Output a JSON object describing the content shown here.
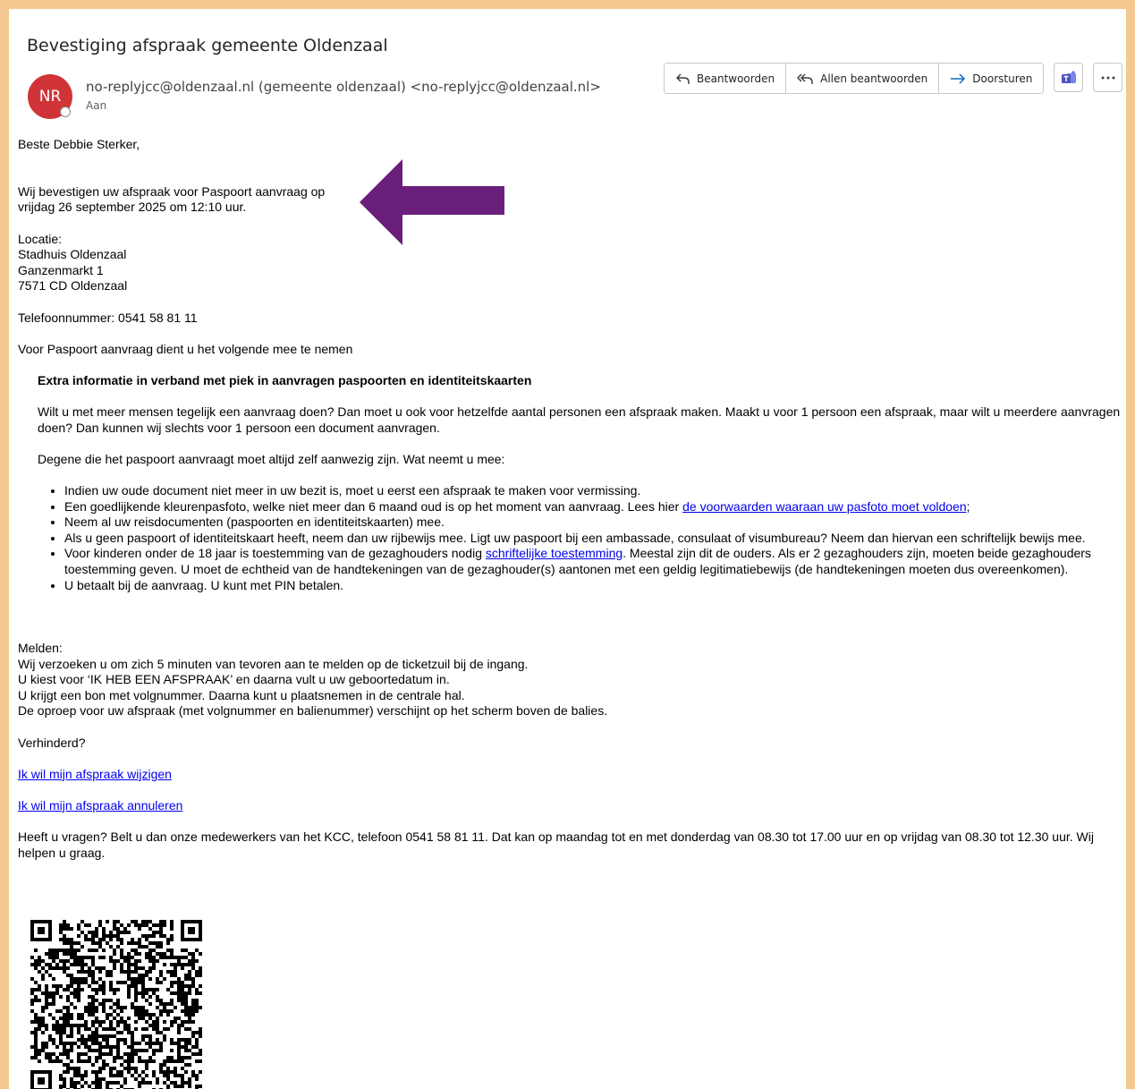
{
  "email": {
    "subject": "Bevestiging afspraak gemeente Oldenzaal",
    "avatar_initials": "NR",
    "avatar_color": "#d13438",
    "sender": "no-replyjcc@oldenzaal.nl (gemeente oldenzaal) <no-replyjcc@oldenzaal.nl>",
    "to_label": "Aan"
  },
  "actions": {
    "reply_label": "Beantwoorden",
    "reply_all_label": "Allen beantwoorden",
    "forward_label": "Doorsturen",
    "teams_icon": "teams-icon",
    "more_icon": "more-icon"
  },
  "body": {
    "greeting": "Beste Debbie Sterker,",
    "confirm_line1": "Wij bevestigen uw afspraak voor Paspoort aanvraag op",
    "confirm_line2": "vrijdag 26 september 2025 om 12:10 uur.",
    "location_label": "Locatie:",
    "location_name": "Stadhuis Oldenzaal",
    "location_street": "Ganzenmarkt 1",
    "location_city": "7571 CD Oldenzaal",
    "phone": "Telefoonnummer: 0541 58 81 11",
    "bring_intro": "Voor Paspoort aanvraag dient u het volgende mee te nemen",
    "extra_heading": "Extra informatie in verband met piek in aanvragen paspoorten en identiteitskaarten",
    "extra_p1": "Wilt u met meer mensen tegelijk een aanvraag doen? Dan moet u ook voor hetzelfde aantal personen een afspraak maken. Maakt u voor 1 persoon een afspraak, maar wilt u meerdere aanvragen doen? Dan kunnen wij slechts voor 1 persoon een document aanvragen.",
    "extra_p2": "Degene die het paspoort aanvraagt moet altijd zelf aanwezig zijn. Wat neemt u mee:",
    "bullet1": "Indien uw oude document niet meer in uw bezit is, moet u eerst een afspraak te maken voor vermissing.",
    "bullet2_pre": "Een goedlijkende kleurenpasfoto, welke niet meer dan 6 maand oud is op het moment van aanvraag. Lees hier ",
    "bullet2_link": "de voorwaarden waaraan uw pasfoto moet voldoen",
    "bullet2_post": ";",
    "bullet3": "Neem al uw reisdocumenten (paspoorten en identiteitskaarten) mee.",
    "bullet4": "Als u geen paspoort of identiteitskaart heeft, neem dan uw rijbewijs mee. Ligt uw paspoort bij een ambassade, consulaat of visumbureau? Neem dan hiervan een schriftelijk bewijs mee.",
    "bullet5_pre": "Voor kinderen onder de 18 jaar is toestemming van de gezaghouders nodig ",
    "bullet5_link": "schriftelijke toestemming",
    "bullet5_post": ". Meestal zijn dit de ouders. Als er 2 gezaghouders zijn, moeten beide gezaghouders toestemming geven. U moet de echtheid van de handtekeningen van de gezaghouder(s) aantonen met een geldig legitimatiebewijs (de handtekeningen moeten dus overeenkomen).",
    "bullet6": "U betaalt bij de aanvraag. U kunt met PIN betalen.",
    "melden_label": "Melden:",
    "melden1": "Wij verzoeken u om zich 5 minuten van tevoren aan te melden op de ticketzuil bij de ingang.",
    "melden2": "U kiest voor ‘IK HEB EEN AFSPRAAK’ en daarna vult u uw geboortedatum in.",
    "melden3": "U krijgt een bon met volgnummer. Daarna kunt u plaatsnemen in de centrale hal.",
    "melden4": "De oproep voor uw afspraak (met volgnummer en balienummer) verschijnt op het scherm boven de balies.",
    "verhinderd": "Verhinderd?",
    "link_change": "Ik wil mijn afspraak wijzigen",
    "link_cancel": "Ik wil mijn afspraak annuleren",
    "questions": "Heeft u vragen? Belt u dan onze medewerkers van het KCC, telefoon 0541 58 81 11. Dat kan op maandag tot en met donderdag van 08.30 tot 17.00 uur en op vrijdag van 08.30 tot 12.30 uur. Wij helpen u graag."
  },
  "annotation": {
    "arrow_color": "#6b1f7c",
    "frame_color": "#f3c78f"
  }
}
